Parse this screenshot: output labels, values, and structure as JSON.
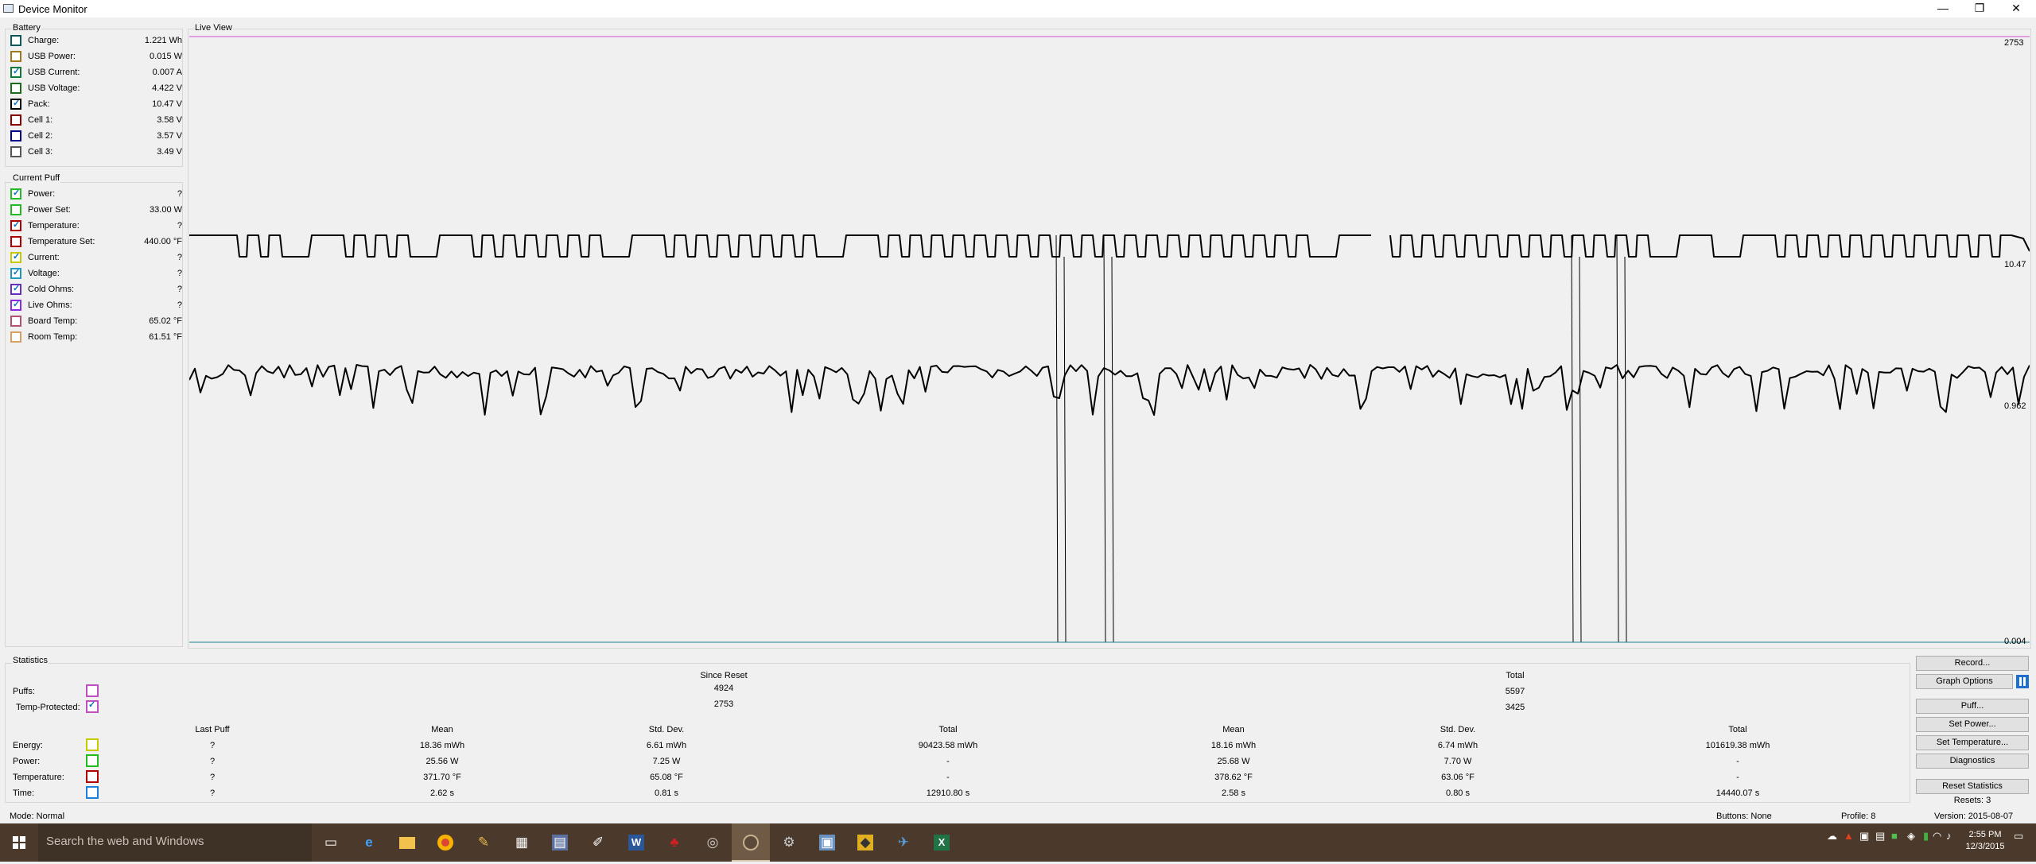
{
  "window": {
    "title": "Device Monitor",
    "minimize": "—",
    "restore": "❐",
    "close": "✕"
  },
  "battery": {
    "title": "Battery",
    "rows": [
      {
        "label": "Charge:",
        "value": "1.221 Wh",
        "checked": false,
        "color": "#0b5a5a"
      },
      {
        "label": "USB Power:",
        "value": "0.015 W",
        "checked": false,
        "color": "#a0781e"
      },
      {
        "label": "USB Current:",
        "value": "0.007 A",
        "checked": true,
        "color": "#0d7a3a"
      },
      {
        "label": "USB Voltage:",
        "value": "4.422 V",
        "checked": false,
        "color": "#1a6b1a"
      },
      {
        "label": "Pack:",
        "value": "10.47 V",
        "checked": true,
        "color": "#000000"
      },
      {
        "label": "Cell 1:",
        "value": "3.58 V",
        "checked": false,
        "color": "#8b0000"
      },
      {
        "label": "Cell 2:",
        "value": "3.57 V",
        "checked": false,
        "color": "#00008b"
      },
      {
        "label": "Cell 3:",
        "value": "3.49 V",
        "checked": false,
        "color": "#555555"
      }
    ]
  },
  "current_puff": {
    "title": "Current Puff",
    "rows": [
      {
        "label": "Power:",
        "value": "?",
        "checked": true,
        "color": "#22bb22"
      },
      {
        "label": "Power Set:",
        "value": "33.00 W",
        "checked": false,
        "color": "#22bb22"
      },
      {
        "label": "Temperature:",
        "value": "?",
        "checked": true,
        "color": "#b00000"
      },
      {
        "label": "Temperature Set:",
        "value": "440.00 °F",
        "checked": false,
        "color": "#b00000"
      },
      {
        "label": "Current:",
        "value": "?",
        "checked": true,
        "color": "#c9c900"
      },
      {
        "label": "Voltage:",
        "value": "?",
        "checked": true,
        "color": "#1e9bbf"
      },
      {
        "label": "Cold Ohms:",
        "value": "?",
        "checked": true,
        "color": "#6b2fbf"
      },
      {
        "label": "Live Ohms:",
        "value": "?",
        "checked": true,
        "color": "#8a2be2"
      },
      {
        "label": "Board Temp:",
        "value": "65.02 °F",
        "checked": false,
        "color": "#b05070"
      },
      {
        "label": "Room Temp:",
        "value": "61.51 °F",
        "checked": false,
        "color": "#d8a060"
      }
    ]
  },
  "live_view": {
    "title": "Live View",
    "labels": {
      "top": "2753",
      "pack": "10.47",
      "mid": "0.962",
      "bottom": "0.004"
    }
  },
  "chart_data": {
    "type": "line",
    "title": "Live View",
    "series": [
      {
        "name": "",
        "color": "#d050d0",
        "level": 2753
      },
      {
        "name": "",
        "color": "#000000",
        "last": 10.47
      },
      {
        "name": "",
        "color": "#000000",
        "last": 0.962
      },
      {
        "name": "",
        "color": "#1a7f8f",
        "last": 0.004
      }
    ]
  },
  "statistics": {
    "title": "Statistics",
    "since_reset_label": "Since Reset",
    "total_label": "Total",
    "puffs_label": "Puffs:",
    "temp_protected_label": "Temp-Protected:",
    "puffs_since_reset": "4924",
    "puffs_total": "5597",
    "temp_since_reset": "2753",
    "temp_total": "3425",
    "columns": [
      "Last Puff",
      "Mean",
      "Std. Dev.",
      "Total",
      "Mean",
      "Std. Dev.",
      "Total"
    ],
    "rows": [
      {
        "label": "Energy:",
        "color": "#c9c900",
        "checked": false,
        "values": [
          "?",
          "18.36 mWh",
          "6.61 mWh",
          "90423.58 mWh",
          "18.16 mWh",
          "6.74 mWh",
          "101619.38 mWh"
        ]
      },
      {
        "label": "Power:",
        "color": "#22bb22",
        "checked": false,
        "values": [
          "?",
          "25.56 W",
          "7.25 W",
          "-",
          "25.68 W",
          "7.70 W",
          "-"
        ]
      },
      {
        "label": "Temperature:",
        "color": "#b00000",
        "checked": false,
        "values": [
          "?",
          "371.70 °F",
          "65.08 °F",
          "-",
          "378.62 °F",
          "63.06 °F",
          "-"
        ]
      },
      {
        "label": "Time:",
        "color": "#1e7fd8",
        "checked": false,
        "values": [
          "?",
          "2.62 s",
          "0.81 s",
          "12910.80 s",
          "2.58 s",
          "0.80 s",
          "14440.07 s"
        ]
      }
    ]
  },
  "buttons": {
    "record": "Record...",
    "graph_options": "Graph Options",
    "puff": "Puff...",
    "set_power": "Set Power...",
    "set_temperature": "Set Temperature...",
    "diagnostics": "Diagnostics",
    "reset_statistics": "Reset Statistics",
    "resets": "Resets: 3"
  },
  "status": {
    "mode": "Mode: Normal",
    "buttons": "Buttons: None",
    "profile": "Profile: 8",
    "version": "Version: 2015-08-07"
  },
  "taskbar": {
    "search_placeholder": "Search the web and Windows",
    "time": "2:55 PM",
    "date": "12/3/2015"
  }
}
